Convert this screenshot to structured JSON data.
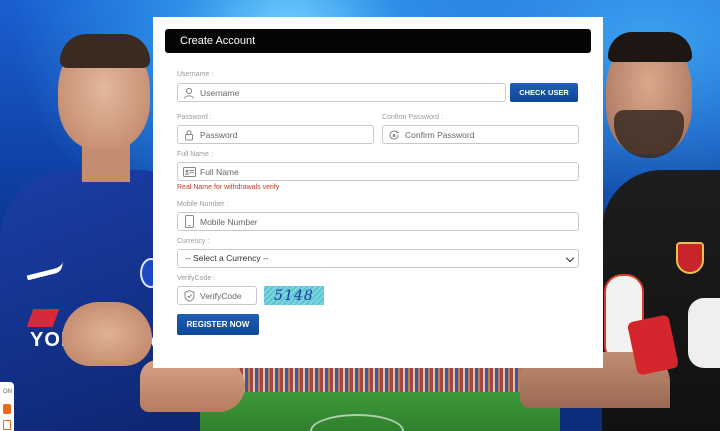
{
  "form": {
    "title": "Create Account",
    "username": {
      "label": "Username :",
      "placeholder": "Username",
      "check_button": "CHECK USER"
    },
    "password": {
      "label": "Password :",
      "placeholder": "Password"
    },
    "confirm_password": {
      "label": "Confirm Password :",
      "placeholder": "Confirm Password"
    },
    "full_name": {
      "label": "Full Name :",
      "placeholder": "Full Name",
      "hint": "Real Name for withdrawals verify"
    },
    "mobile": {
      "label": "Mobile Number :",
      "placeholder": "Mobile Number"
    },
    "currency": {
      "label": "Currency :",
      "selected": "-- Select a Currency --"
    },
    "verify": {
      "label": "VerifyCode :",
      "placeholder": "VerifyCode",
      "captcha": "5148"
    },
    "register_button": "REGISTER NOW"
  },
  "background": {
    "left_player_sponsor": "YOKOHAMA",
    "colors": {
      "accent": "#0e4599",
      "header": "#050505",
      "hint": "#c0392b"
    }
  },
  "side_widget": {
    "text": "ON"
  }
}
